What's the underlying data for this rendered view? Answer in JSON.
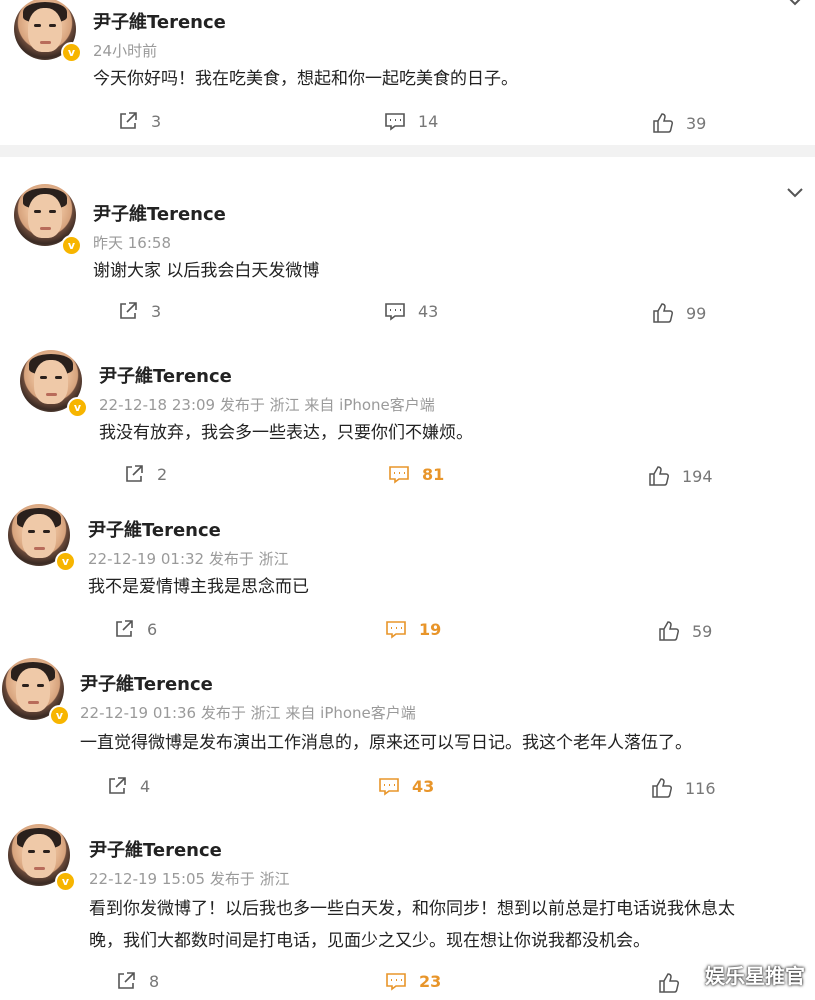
{
  "watermark": "娱乐星推官",
  "colors": {
    "verified_badge": "#f7b500",
    "hot_comment": "#e8952a",
    "meta_gray": "#9a9a9a"
  },
  "posts": [
    {
      "author": "尹子維Terence",
      "meta": "24小时前",
      "text": "今天你好吗！我在吃美食，想起和你一起吃美食的日子。",
      "reposts": "3",
      "comments": "14",
      "likes": "39"
    },
    {
      "author": "尹子維Terence",
      "meta": "昨天 16:58",
      "text": "谢谢大家 以后我会白天发微博",
      "reposts": "3",
      "comments": "43",
      "likes": "99"
    },
    {
      "author": "尹子維Terence",
      "meta": "22-12-18 23:09  发布于 浙江  来自 iPhone客户端",
      "text": "我没有放弃，我会多一些表达，只要你们不嫌烦。",
      "reposts": "2",
      "comments": "81",
      "likes": "194"
    },
    {
      "author": "尹子維Terence",
      "meta": "22-12-19 01:32  发布于 浙江",
      "text": "我不是爱情博主我是思念而已",
      "reposts": "6",
      "comments": "19",
      "likes": "59"
    },
    {
      "author": "尹子維Terence",
      "meta": "22-12-19 01:36  发布于 浙江  来自 iPhone客户端",
      "text": "一直觉得微博是发布演出工作消息的，原来还可以写日记。我这个老年人落伍了。",
      "reposts": "4",
      "comments": "43",
      "likes": "116"
    },
    {
      "author": "尹子維Terence",
      "meta": "22-12-19 15:05  发布于 浙江",
      "text_lines": [
        "看到你发微博了！以后我也多一些白天发，和你同步！想到以前总是打电话说我休息太",
        "晚，我们大都数时间是打电话，见面少之又少。现在想让你说我都没机会。"
      ],
      "reposts": "8",
      "comments": "23",
      "likes": ""
    }
  ],
  "icons": {
    "repost": "share-box-icon",
    "comment": "comment-bubble-icon",
    "like": "thumbs-up-icon",
    "more": "chevron-down-icon",
    "verified": "verified-badge-icon"
  }
}
